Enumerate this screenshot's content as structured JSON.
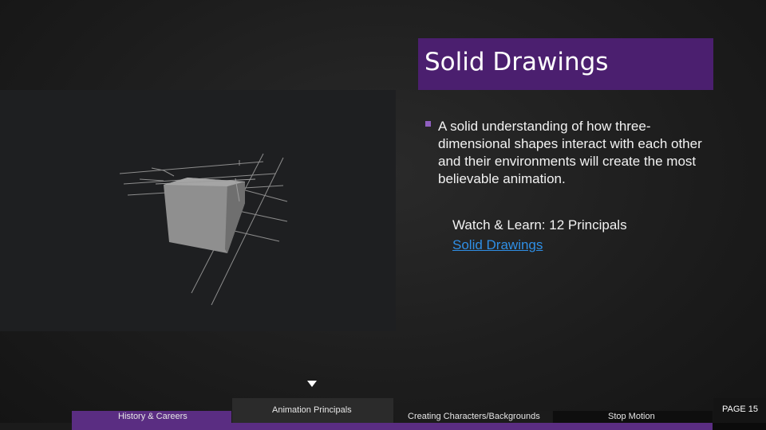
{
  "slide": {
    "title": "Solid Drawings",
    "bullet": "A solid understanding of how three-dimensional shapes interact with each other and their environments will create the most believable animation.",
    "watch_label": "Watch & Learn: 12 Principals",
    "watch_link": "Solid Drawings",
    "illustration": "3d-cube-grid"
  },
  "nav": {
    "items": [
      {
        "label": "History & Careers"
      },
      {
        "label": "Animation Principals"
      },
      {
        "label": "Creating Characters/Backgrounds"
      },
      {
        "label": "Stop Motion"
      }
    ],
    "page_label": "PAGE 15"
  },
  "colors": {
    "accent": "#4b1f6f",
    "nav_accent": "#5a2d82",
    "link": "#2f8fe6"
  }
}
